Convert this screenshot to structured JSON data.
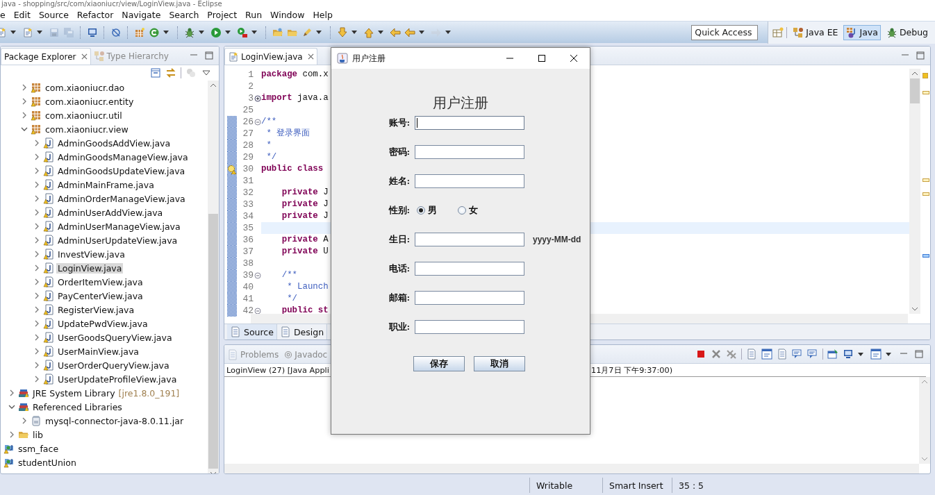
{
  "window": {
    "title": "java - shopping/src/com/xiaoniucr/view/LoginView.java - Eclipse"
  },
  "menu": [
    "e",
    "Edit",
    "Source",
    "Refactor",
    "Navigate",
    "Search",
    "Project",
    "Run",
    "Window",
    "Help"
  ],
  "quick_access": {
    "placeholder": "Quick Access"
  },
  "perspectives": [
    {
      "label": "Java EE",
      "selected": false
    },
    {
      "label": "Java",
      "selected": true
    },
    {
      "label": "Debug",
      "selected": false
    }
  ],
  "explorer": {
    "tabs": [
      {
        "label": "Package Explorer",
        "selected": true
      },
      {
        "label": "Type Hierarchy",
        "selected": false
      }
    ],
    "tree": [
      {
        "children": [
          {
            "children": [
              {
                "label": "com.xiaoniucr.dao",
                "kind": "package",
                "expanded": false,
                "selected": false
              },
              {
                "label": "com.xiaoniucr.entity",
                "kind": "package",
                "expanded": false,
                "selected": false
              },
              {
                "label": "com.xiaoniucr.util",
                "kind": "package",
                "expanded": false,
                "selected": false
              },
              {
                "label": "com.xiaoniucr.view",
                "kind": "package",
                "expanded": true,
                "selected": false,
                "children": [
                  {
                    "label": "AdminGoodsAddView.java",
                    "kind": "java",
                    "expanded": false,
                    "selected": false
                  },
                  {
                    "label": "AdminGoodsManageView.java",
                    "kind": "java",
                    "expanded": false,
                    "selected": false
                  },
                  {
                    "label": "AdminGoodsUpdateView.java",
                    "kind": "java",
                    "expanded": false,
                    "selected": false
                  },
                  {
                    "label": "AdminMainFrame.java",
                    "kind": "java",
                    "expanded": false,
                    "selected": false
                  },
                  {
                    "label": "AdminOrderManageView.java",
                    "kind": "java",
                    "expanded": false,
                    "selected": false
                  },
                  {
                    "label": "AdminUserAddView.java",
                    "kind": "java",
                    "expanded": false,
                    "selected": false
                  },
                  {
                    "label": "AdminUserManageView.java",
                    "kind": "java",
                    "expanded": false,
                    "selected": false
                  },
                  {
                    "label": "AdminUserUpdateView.java",
                    "kind": "java",
                    "expanded": false,
                    "selected": false
                  },
                  {
                    "label": "InvestView.java",
                    "kind": "java",
                    "expanded": false,
                    "selected": false
                  },
                  {
                    "label": "LoginView.java",
                    "kind": "java",
                    "expanded": false,
                    "selected": true
                  },
                  {
                    "label": "OrderItemView.java",
                    "kind": "java",
                    "expanded": false,
                    "selected": false
                  },
                  {
                    "label": "PayCenterView.java",
                    "kind": "java",
                    "expanded": false,
                    "selected": false
                  },
                  {
                    "label": "RegisterView.java",
                    "kind": "java",
                    "expanded": false,
                    "selected": false
                  },
                  {
                    "label": "UpdatePwdView.java",
                    "kind": "java",
                    "expanded": false,
                    "selected": false
                  },
                  {
                    "label": "UserGoodsQueryView.java",
                    "kind": "java",
                    "expanded": false,
                    "selected": false
                  },
                  {
                    "label": "UserMainView.java",
                    "kind": "java",
                    "expanded": false,
                    "selected": false
                  },
                  {
                    "label": "UserOrderQueryView.java",
                    "kind": "java",
                    "expanded": false,
                    "selected": false
                  },
                  {
                    "label": "UserUpdateProfileView.java",
                    "kind": "java",
                    "expanded": false,
                    "selected": false
                  }
                ]
              }
            ]
          },
          {
            "label": "JRE System Library",
            "detail": "[jre1.8.0_191]",
            "kind": "library",
            "expanded": false,
            "selected": false
          },
          {
            "label": "Referenced Libraries",
            "kind": "library",
            "expanded": true,
            "selected": false,
            "children": [
              {
                "label": "mysql-connector-java-8.0.11.jar",
                "kind": "jar",
                "expanded": false,
                "selected": false
              }
            ]
          },
          {
            "label": "lib",
            "kind": "folder",
            "expanded": false,
            "selected": false
          }
        ]
      },
      {
        "label": "ssm_face",
        "kind": "project",
        "selected": false
      },
      {
        "label": "studentUnion",
        "kind": "project",
        "selected": false
      }
    ]
  },
  "editor": {
    "tab": "LoginView.java",
    "lines": [
      {
        "number": "1",
        "text": "**package** com.x",
        "kind": "code",
        "changed": false,
        "current": false
      },
      {
        "number": "2",
        "kind": "code",
        "changed": false,
        "current": false
      },
      {
        "number": "3",
        "text": "**import** java.a",
        "kind": "code",
        "folded": true,
        "changed": false,
        "current": false
      },
      {
        "number": "25",
        "kind": "code",
        "changed": false,
        "current": false
      },
      {
        "number": "26",
        "text": "/**",
        "kind": "comment",
        "folded": false,
        "changed": true,
        "current": false
      },
      {
        "number": "27",
        "text": " * 登录界面",
        "kind": "comment",
        "changed": true,
        "current": false
      },
      {
        "number": "28",
        "text": " *",
        "kind": "comment",
        "changed": true,
        "current": false
      },
      {
        "number": "29",
        "text": " */",
        "kind": "comment",
        "changed": true,
        "current": false
      },
      {
        "number": "30",
        "text": "**public** **class**",
        "kind": "code",
        "warning": true,
        "changed": true,
        "current": false
      },
      {
        "number": "31",
        "kind": "code",
        "changed": true,
        "current": false
      },
      {
        "number": "32",
        "text": "    **private** J",
        "kind": "code",
        "changed": true,
        "current": false
      },
      {
        "number": "33",
        "text": "    **private** J",
        "kind": "code",
        "changed": true,
        "current": false
      },
      {
        "number": "34",
        "text": "    **private** J",
        "kind": "code",
        "changed": true,
        "current": false
      },
      {
        "number": "35",
        "kind": "code",
        "changed": true,
        "current": true
      },
      {
        "number": "36",
        "text": "    **private** A",
        "kind": "code",
        "changed": true,
        "current": false
      },
      {
        "number": "37",
        "text": "    **private** U",
        "kind": "code",
        "changed": true,
        "current": false
      },
      {
        "number": "38",
        "kind": "code",
        "changed": true,
        "current": false
      },
      {
        "number": "39",
        "text": "    /**",
        "kind": "comment",
        "folded": false,
        "changed": true,
        "current": false
      },
      {
        "number": "40",
        "text": "     * Launch",
        "kind": "comment",
        "changed": true,
        "current": false
      },
      {
        "number": "41",
        "text": "     */",
        "kind": "comment",
        "changed": true,
        "current": false
      },
      {
        "number": "42",
        "text": "    **public** **st**",
        "kind": "code",
        "folded": false,
        "changed": true,
        "current": false
      }
    ],
    "bottom_tabs": [
      {
        "label": "Source",
        "selected": true
      },
      {
        "label": "Design",
        "selected": false
      }
    ]
  },
  "views": {
    "tabs": [
      {
        "label": "Problems",
        "kind": "problems",
        "selected": false
      },
      {
        "label": "Javadoc",
        "kind": "javadoc",
        "selected": false
      }
    ],
    "console_left": "LoginView (27) [Java Appli",
    "console_right": "11月7日 下午9:37:00)"
  },
  "status": [
    "Writable",
    "Smart Insert",
    "35 : 5"
  ],
  "dialog": {
    "title": "用户注册",
    "heading": "用户注册",
    "rows": [
      {
        "kind": "text",
        "label": "账号:",
        "focused": true
      },
      {
        "kind": "text",
        "label": "密码:",
        "focused": false
      },
      {
        "kind": "text",
        "label": "姓名:",
        "focused": false
      },
      {
        "kind": "radio",
        "label": "性别:",
        "options": [
          {
            "label": "男",
            "selected": true
          },
          {
            "label": "女",
            "selected": false
          }
        ]
      },
      {
        "kind": "text",
        "label": "生日:",
        "focused": false,
        "hint": "yyyy-MM-dd"
      },
      {
        "kind": "text",
        "label": "电话:",
        "focused": false
      },
      {
        "kind": "text",
        "label": "邮箱:",
        "focused": false
      },
      {
        "kind": "text",
        "label": "职业:",
        "focused": false
      }
    ],
    "buttons": [
      "保存",
      "取消"
    ]
  }
}
